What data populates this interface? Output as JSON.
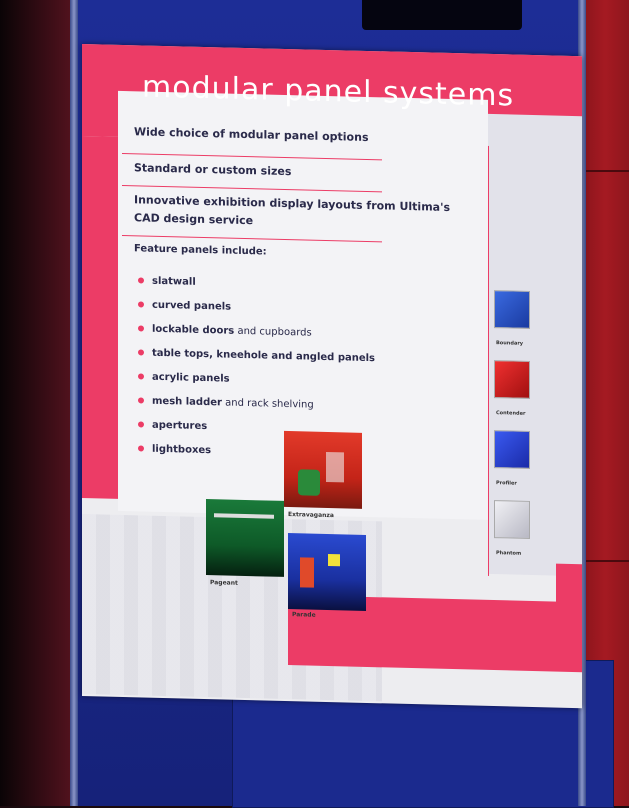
{
  "sign": {
    "title": "modular panel systems",
    "points": [
      "Wide choice of modular panel options",
      "Standard or custom sizes",
      "Innovative exhibition display layouts from Ultima's",
      "CAD design service"
    ],
    "feature_heading": "Feature panels include:",
    "features": [
      {
        "bold": "slatwall",
        "rest": ""
      },
      {
        "bold": "curved panels",
        "rest": ""
      },
      {
        "bold": "lockable doors",
        "rest": " and cupboards"
      },
      {
        "bold": "table tops, kneehole and angled panels",
        "rest": ""
      },
      {
        "bold": "acrylic panels",
        "rest": ""
      },
      {
        "bold": "mesh ladder",
        "rest": " and rack shelving"
      },
      {
        "bold": "apertures",
        "rest": ""
      },
      {
        "bold": "lightboxes",
        "rest": ""
      }
    ],
    "booths": {
      "extravaganza": "Extravaganza",
      "pageant": "Pageant",
      "parade": "Parade"
    },
    "panels": {
      "boundary": "Boundary",
      "contender": "Contender",
      "profiler": "Profiler",
      "phantom": "Phantom"
    }
  },
  "colors": {
    "accent_pink": "#ec3c66",
    "booth_blue": "#1d2d96",
    "text_dark": "#2a2a4a"
  }
}
